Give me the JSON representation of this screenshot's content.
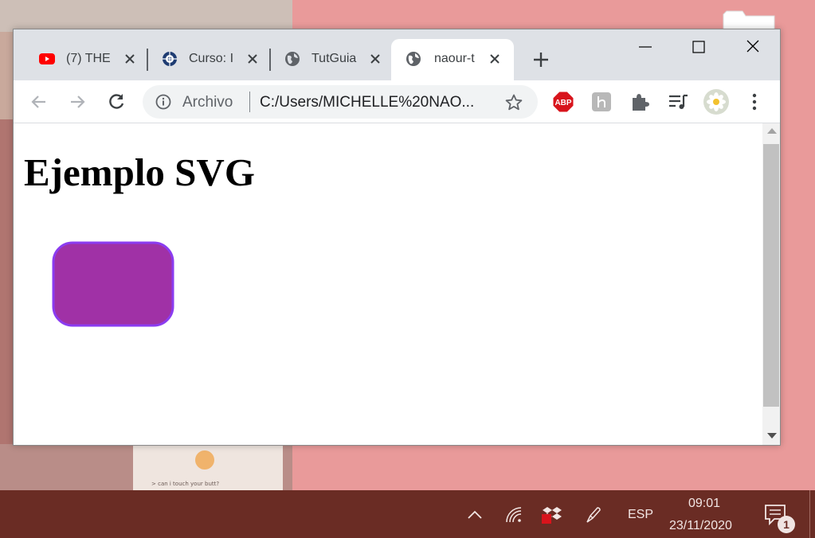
{
  "browser": {
    "tabs": [
      {
        "title": "(7) THE",
        "icon": "youtube-icon",
        "active": false
      },
      {
        "title": "Curso: I",
        "icon": "course-site-icon",
        "active": false
      },
      {
        "title": "TutGuia",
        "icon": "globe-icon",
        "active": false
      },
      {
        "title": "naour-t",
        "icon": "globe-icon",
        "active": true
      }
    ],
    "address_bar": {
      "scheme_label": "Archivo",
      "url": "C:/Users/MICHELLE%20NAO..."
    },
    "extensions": [
      "adblock-plus-icon",
      "honey-icon",
      "extensions-puzzle-icon",
      "media-control-icon",
      "profile-avatar-icon"
    ],
    "abp_label": "ABP",
    "colors": {
      "tabstrip": "#dee1e6",
      "omnibox": "#f1f3f4"
    }
  },
  "page": {
    "heading": "Ejemplo SVG",
    "rect": {
      "fill": "#a031a6",
      "stroke": "#8b3cf0"
    }
  },
  "taskbar": {
    "language": "ESP",
    "time": "09:01",
    "date": "23/11/2020",
    "notification_count": "1",
    "colors": {
      "background": "#6a2c24"
    }
  },
  "wallpaper": {
    "photo_caption": "> can i touch your butt?"
  }
}
